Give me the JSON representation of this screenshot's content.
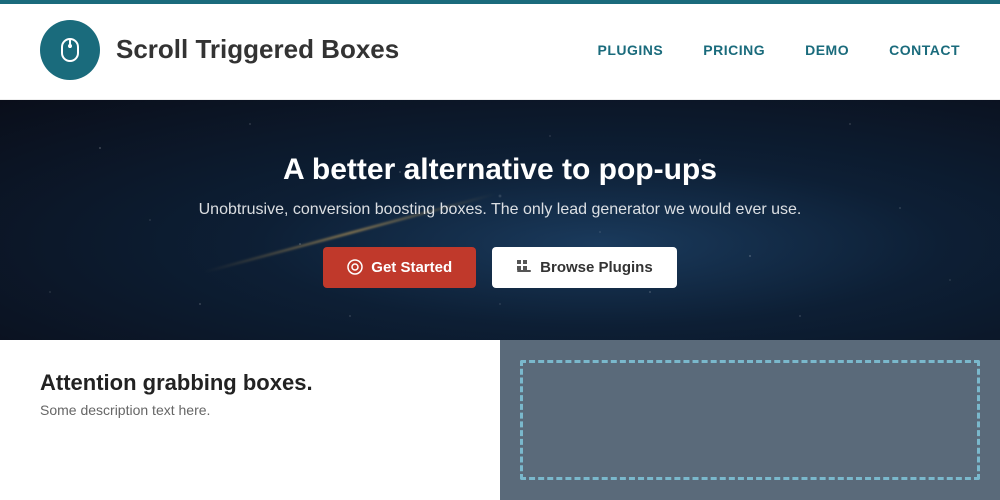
{
  "header": {
    "logo_text": "Scroll Triggered Boxes",
    "nav_items": [
      {
        "label": "PLUGINS",
        "id": "plugins"
      },
      {
        "label": "PRICING",
        "id": "pricing"
      },
      {
        "label": "DEMO",
        "id": "demo"
      },
      {
        "label": "CONTACT",
        "id": "contact"
      }
    ]
  },
  "hero": {
    "title": "A better alternative to pop-ups",
    "subtitle": "Unobtrusive, conversion boosting boxes. The only lead generator we would ever use.",
    "btn_get_started": "Get Started",
    "btn_browse": "Browse Plugins"
  },
  "below": {
    "title": "Attention grabbing boxes.",
    "subtitle": "Some description text here.",
    "colors": {
      "teal": "#1a6b7c",
      "red": "#c0392b",
      "dark_bg": "#5a6a7a"
    }
  }
}
